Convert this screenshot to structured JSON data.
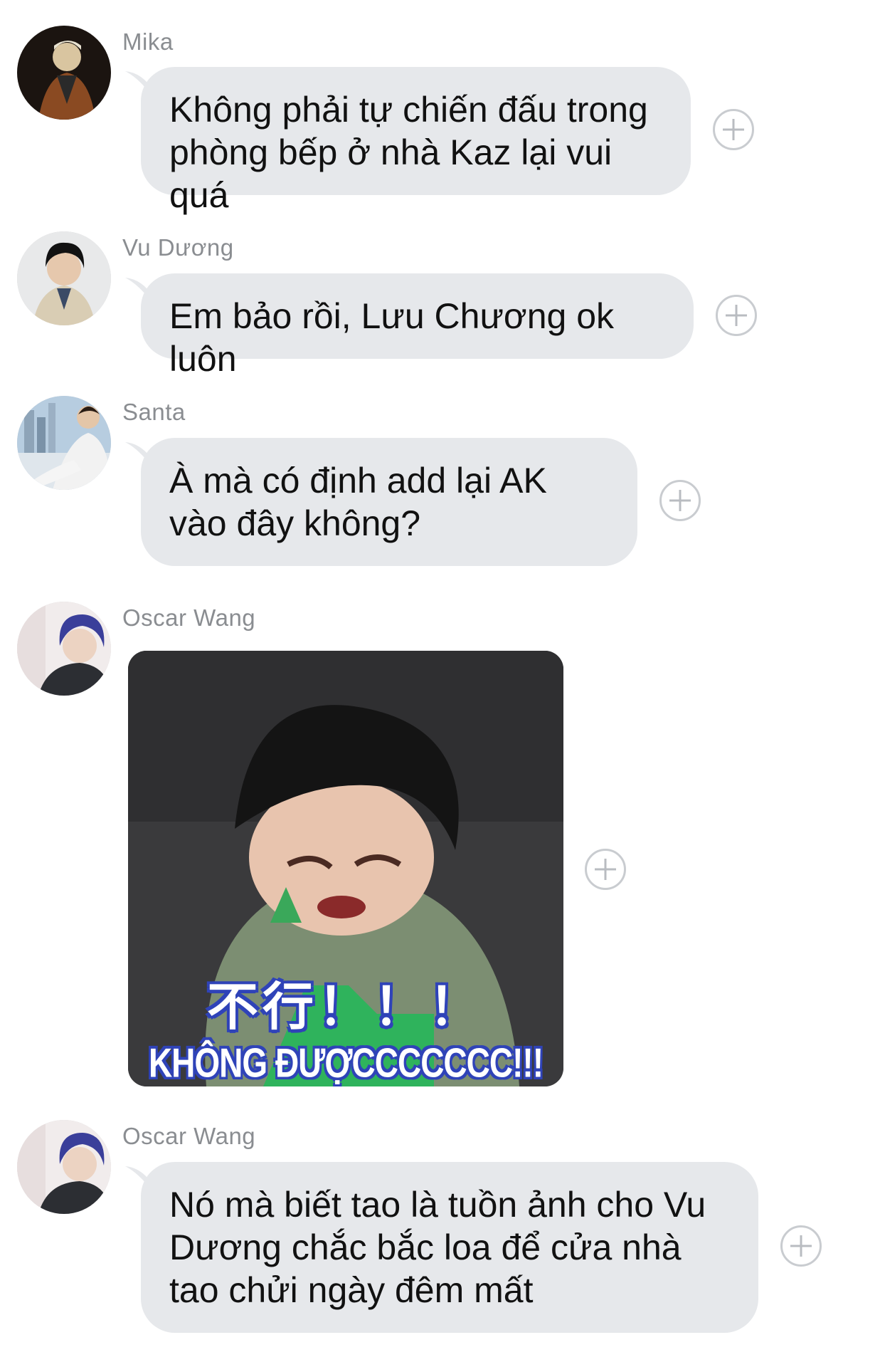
{
  "messages": [
    {
      "sender": "Mika",
      "avatar": "avatar-mika",
      "text": "Không phải tự chiến đấu trong phòng bếp ở nhà Kaz lại vui quá"
    },
    {
      "sender": "Vu Dương",
      "avatar": "avatar-vu-duong",
      "text": "Em bảo rồi, Lưu Chương ok luôn"
    },
    {
      "sender": "Santa",
      "avatar": "avatar-santa",
      "text": "À mà có định add lại AK vào đây không?"
    },
    {
      "sender": "Oscar Wang",
      "avatar": "avatar-oscar-wang",
      "sticker": {
        "caption_cn": "不行！！！",
        "caption_vn": "KHÔNG ĐƯỢCCCCCCC!!!"
      }
    },
    {
      "sender": "Oscar Wang",
      "avatar": "avatar-oscar-wang",
      "text": "Nó mà biết tao là tuồn ảnh cho Vu Dương chắc bắc loa để cửa nhà tao chửi ngày đêm mất"
    }
  ],
  "icons": {
    "reaction": "plus-circle-icon"
  },
  "colors": {
    "bubble": "#e6e8eb",
    "sender_name": "#8a8d91",
    "background": "#ffffff"
  }
}
